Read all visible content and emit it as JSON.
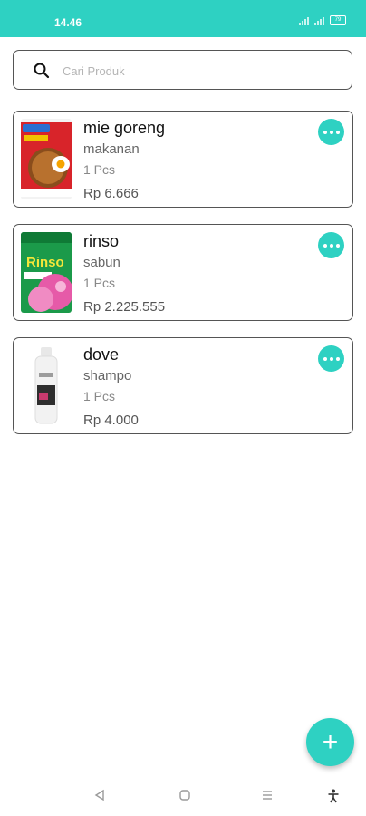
{
  "status_bar": {
    "time": "14.46",
    "battery": "79",
    "color": "#2ed1c2"
  },
  "search": {
    "placeholder": "Cari Produk",
    "value": ""
  },
  "products": [
    {
      "name": "mie goreng",
      "category": "makanan",
      "quantity": "1 Pcs",
      "price": "Rp 6.666",
      "image_icon": "noodle-package-icon"
    },
    {
      "name": "rinso",
      "category": "sabun",
      "quantity": "1 Pcs",
      "price": "Rp 2.225.555",
      "image_icon": "detergent-package-icon"
    },
    {
      "name": "dove",
      "category": "shampo",
      "quantity": "1 Pcs",
      "price": "Rp 4.000",
      "image_icon": "shampoo-bottle-icon"
    }
  ],
  "fab": {
    "label": "+",
    "icon": "plus-icon"
  },
  "nav_bar": {
    "icons": [
      "back-icon",
      "home-icon",
      "menu-icon",
      "accessibility-icon"
    ]
  },
  "colors": {
    "accent": "#2ed1c2",
    "border": "#555555"
  }
}
